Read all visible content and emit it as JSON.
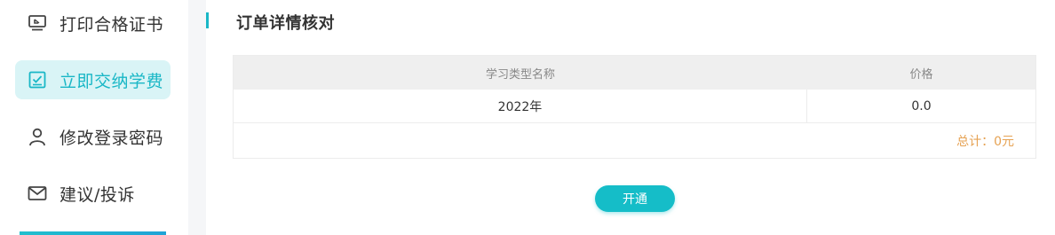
{
  "sidebar": {
    "items": [
      {
        "label": "打印合格证书",
        "icon": "certificate-monitor-icon",
        "active": false
      },
      {
        "label": "立即交纳学费",
        "icon": "checkbox-icon",
        "active": true
      },
      {
        "label": "修改登录密码",
        "icon": "user-icon",
        "active": false
      },
      {
        "label": "建议/投诉",
        "icon": "mail-icon",
        "active": false
      }
    ]
  },
  "main": {
    "title": "订单详情核对",
    "table": {
      "headers": [
        "学习类型名称",
        "价格"
      ],
      "rows": [
        [
          "2022年",
          "0.0"
        ]
      ],
      "total": "总计：0元"
    },
    "open_button": "开通"
  },
  "colors": {
    "accent": "#19b7c6",
    "active_bg": "#d9f4f6",
    "total_text": "#e6a253"
  }
}
